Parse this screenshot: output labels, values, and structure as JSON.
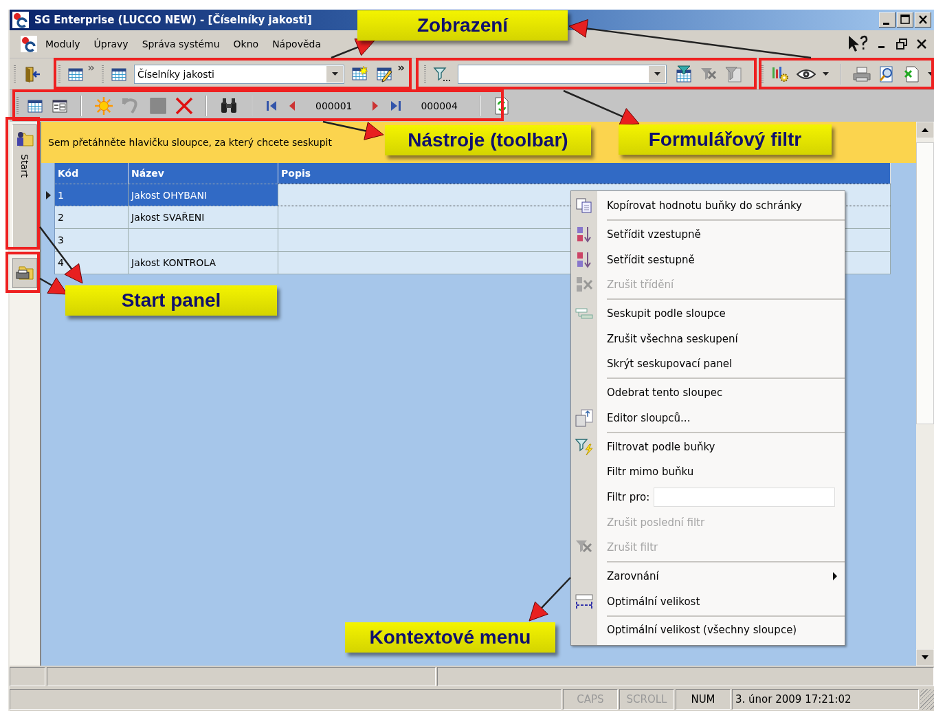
{
  "window": {
    "title": "SG Enterprise (LUCCO NEW) - [Číselníky jakosti]"
  },
  "menu": [
    "Moduly",
    "Úpravy",
    "Správa systému",
    "Okno",
    "Nápověda"
  ],
  "toolbar": {
    "module_combo": {
      "value": "Číselníky jakosti"
    }
  },
  "navigator": {
    "first_record": "000001",
    "last_record": "000004"
  },
  "start_panel": {
    "tab_label": "Start"
  },
  "group_panel": {
    "hint": "Sem přetáhněte hlavičku sloupce, za který chcete seskupit"
  },
  "grid": {
    "columns": [
      "Kód",
      "Název",
      "Popis"
    ],
    "rows": [
      {
        "cells": [
          "1",
          "Jakost OHYBANI"
        ],
        "selected": true
      },
      {
        "cells": [
          "2",
          "Jakost SVAŘENI"
        ],
        "selected": false
      },
      {
        "cells": [
          "3"
        ],
        "selected": false
      },
      {
        "cells": [
          "4",
          "Jakost KONTROLA"
        ],
        "selected": false
      }
    ]
  },
  "context_menu": {
    "items": [
      {
        "kind": "item",
        "label": "Kopírovat hodnotu buňky do schránky",
        "disabled": false
      },
      {
        "kind": "separator"
      },
      {
        "kind": "item",
        "label": "Setřídit vzestupně",
        "disabled": false
      },
      {
        "kind": "item",
        "label": "Setřídit sestupně",
        "disabled": false
      },
      {
        "kind": "item",
        "label": "Zrušit třídění",
        "disabled": true
      },
      {
        "kind": "separator"
      },
      {
        "kind": "item",
        "label": "Seskupit podle sloupce",
        "disabled": false
      },
      {
        "kind": "item",
        "label": "Zrušit všechna seskupení",
        "disabled": false
      },
      {
        "kind": "item",
        "label": "Skrýt seskupovací panel",
        "disabled": false
      },
      {
        "kind": "separator"
      },
      {
        "kind": "item",
        "label": "Odebrat tento sloupec",
        "disabled": false
      },
      {
        "kind": "item",
        "label": "Editor sloupců...",
        "disabled": false
      },
      {
        "kind": "separator"
      },
      {
        "kind": "item",
        "label": "Filtrovat podle buňky",
        "disabled": false
      },
      {
        "kind": "item",
        "label": "Filtr mimo buňku",
        "disabled": false
      },
      {
        "kind": "input",
        "label": "Filtr pro:"
      },
      {
        "kind": "item",
        "label": "Zrušit poslední filtr",
        "disabled": true
      },
      {
        "kind": "item",
        "label": "Zrušit filtr",
        "disabled": true
      },
      {
        "kind": "separator"
      },
      {
        "kind": "submenu",
        "label": "Zarovnání",
        "disabled": false
      },
      {
        "kind": "item",
        "label": "Optimální velikost",
        "disabled": false
      },
      {
        "kind": "separator"
      },
      {
        "kind": "item",
        "label": "Optimální velikost (všechny sloupce)",
        "disabled": false
      }
    ]
  },
  "status_bar": {
    "indicators": [
      {
        "label": "CAPS",
        "on": false
      },
      {
        "label": "SCROLL",
        "on": false
      },
      {
        "label": "NUM",
        "on": true
      }
    ],
    "datetime": "3. únor 2009 17:21:02"
  },
  "annotations": [
    "Zobrazení",
    "Nástroje (toolbar)",
    "Formulářový filtr",
    "Start panel",
    "Kontextové menu"
  ]
}
